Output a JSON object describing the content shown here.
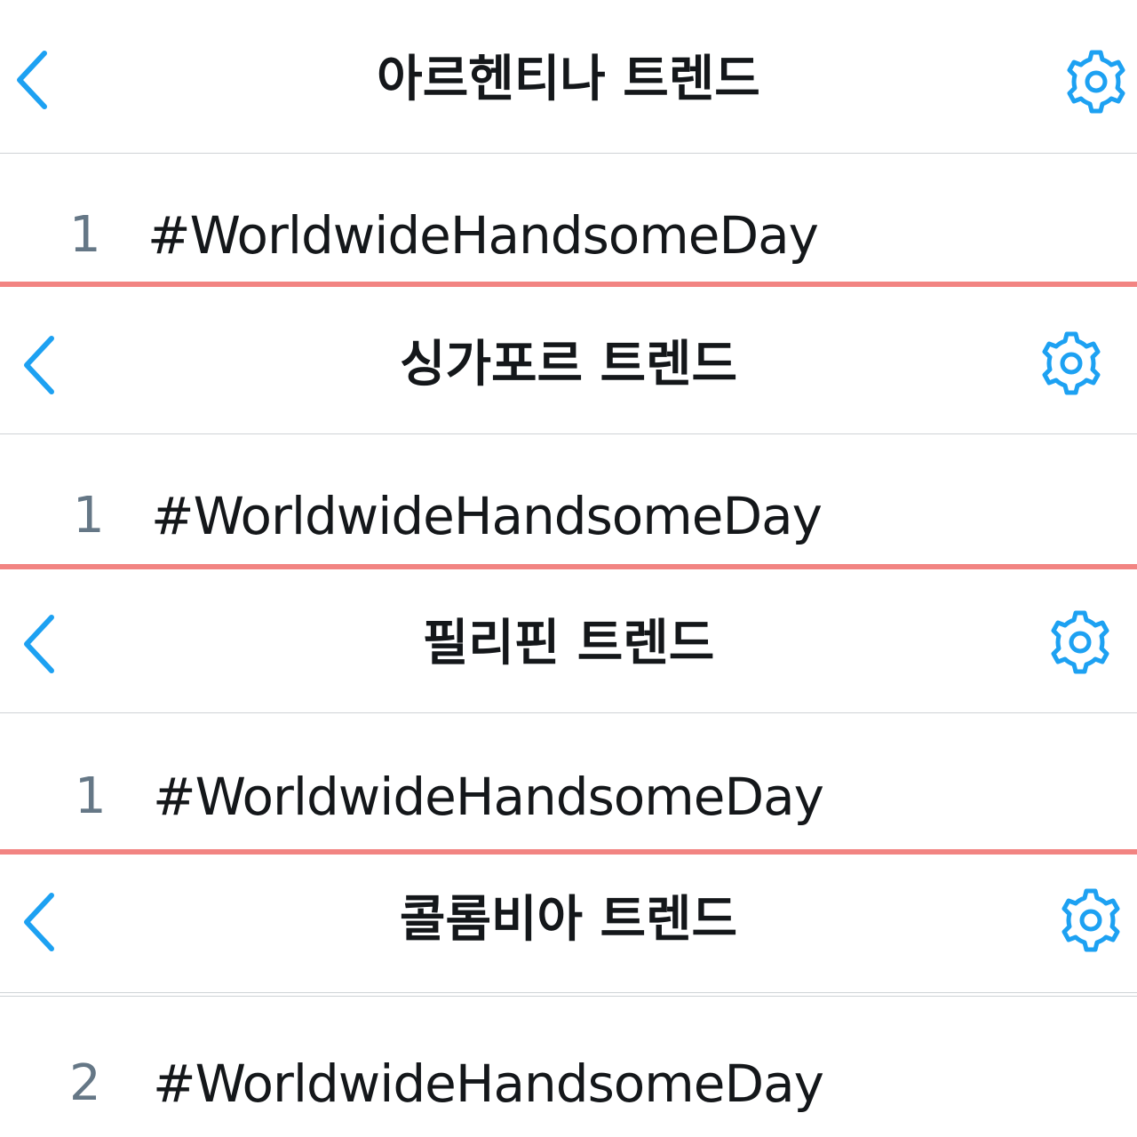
{
  "colors": {
    "accent": "#1da1f2",
    "title_text": "#14171a",
    "rank_text": "#657786",
    "separator": "#f28482",
    "divider": "#cfd3d6"
  },
  "panels": [
    {
      "title": "아르헨티나 트렌드",
      "back_icon": "chevron-left-icon",
      "settings_icon": "gear-icon",
      "trend": {
        "rank": "1",
        "hashtag": "#WorldwideHandsomeDay"
      }
    },
    {
      "title": "싱가포르 트렌드",
      "back_icon": "chevron-left-icon",
      "settings_icon": "gear-icon",
      "trend": {
        "rank": "1",
        "hashtag": "#WorldwideHandsomeDay"
      }
    },
    {
      "title": "필리핀 트렌드",
      "back_icon": "chevron-left-icon",
      "settings_icon": "gear-icon",
      "trend": {
        "rank": "1",
        "hashtag": "#WorldwideHandsomeDay"
      }
    },
    {
      "title": "콜롬비아 트렌드",
      "back_icon": "chevron-left-icon",
      "settings_icon": "gear-icon",
      "trend": {
        "rank": "2",
        "hashtag": "#WorldwideHandsomeDay"
      }
    }
  ]
}
